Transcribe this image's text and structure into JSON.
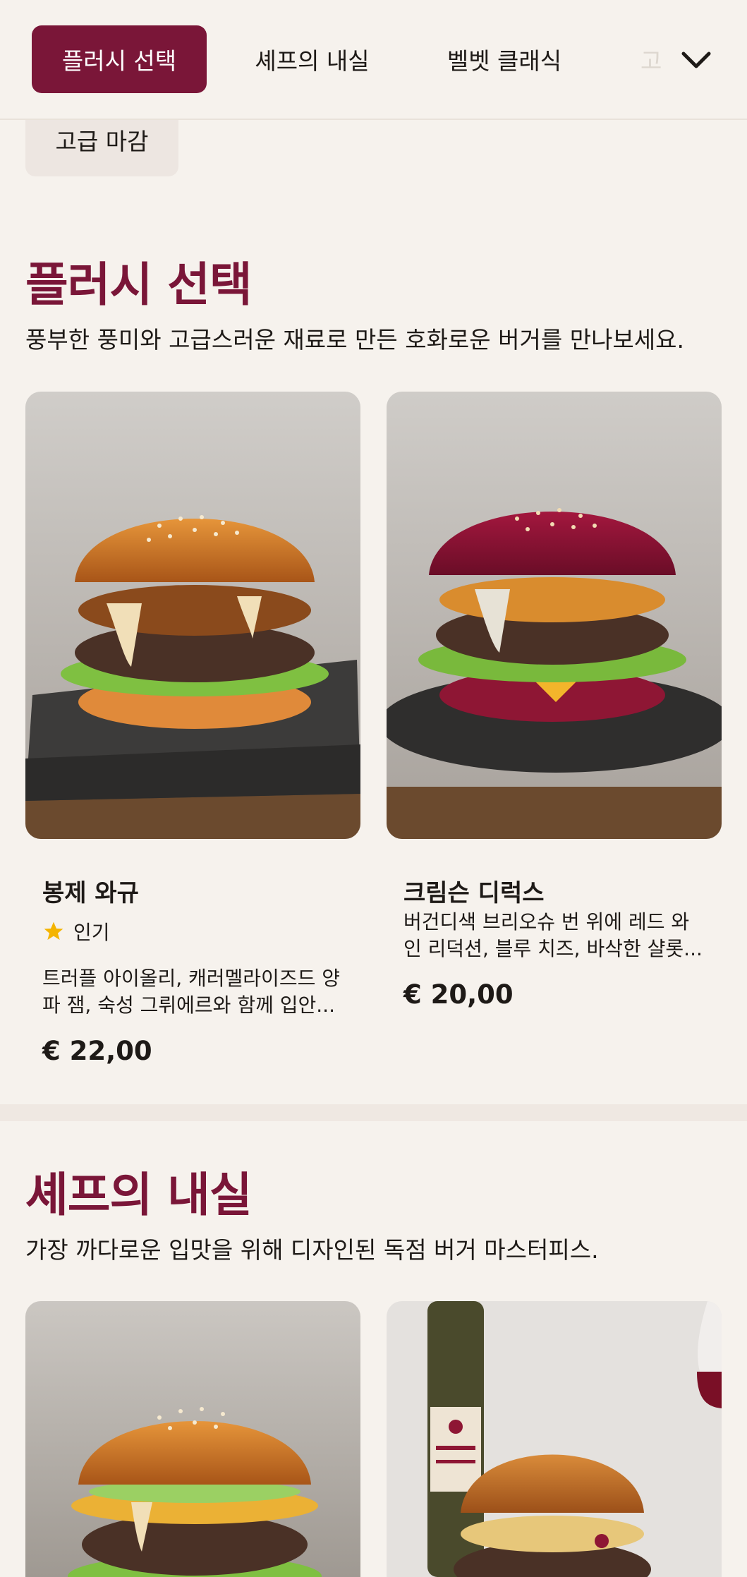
{
  "categories": [
    {
      "label": "플러시 선택",
      "active": true
    },
    {
      "label": "셰프의 내실",
      "active": false
    },
    {
      "label": "벨벳 클래식",
      "active": false
    },
    {
      "label": "고",
      "active": false
    }
  ],
  "chip_row": {
    "label": "고급 마감"
  },
  "sections": [
    {
      "title": "플러시 선택",
      "description": "풍부한 풍미와 고급스러운 재료로 만든 호화로운 버거를 만나보세요.",
      "items": [
        {
          "name": "봉제 와규",
          "badge": "인기",
          "description": "트러플 아이올리, 캐러멜라이즈드 양파 잼, 숙성 그뤼에르와 함께 입안...",
          "price": "€ 22,00"
        },
        {
          "name": "크림슨 디럭스",
          "description": "버건디색 브리오슈 번 위에 레드 와인 리덕션, 블루 치즈, 바삭한 샬롯...",
          "price": "€ 20,00"
        }
      ]
    },
    {
      "title": "셰프의 내실",
      "description": "가장 까다로운 입맛을 위해 디자인된 독점 버거 마스터피스."
    }
  ],
  "icons": {
    "expand": "chevron-down-icon",
    "badge": "star-icon"
  },
  "colors": {
    "accent": "#7a1638",
    "background": "#f6f2ed",
    "star": "#f4b400"
  }
}
